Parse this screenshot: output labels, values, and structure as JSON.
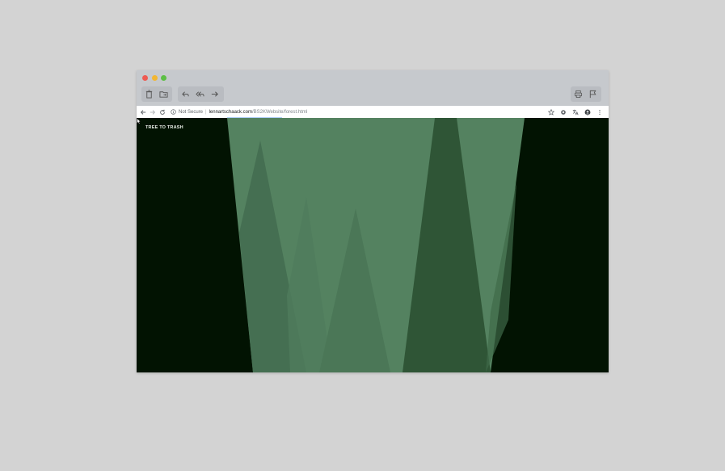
{
  "browser": {
    "traffic_lights": [
      "close",
      "minimize",
      "zoom"
    ],
    "toolbar_left": [
      "trash-icon",
      "folder-icon"
    ],
    "toolbar_mid": [
      "reply-icon",
      "reply-all-icon",
      "forward-icon"
    ],
    "toolbar_right": [
      "print-icon",
      "flag-icon"
    ]
  },
  "navbar": {
    "security_label": "Not Secure",
    "separator": "|",
    "url_host": "lennartschaack.com",
    "url_path": "/BS2KWebsite/forest.html"
  },
  "page": {
    "title": "TREE TO TRASH",
    "colors": {
      "background": "#021302",
      "light_green": "#548260",
      "mid_green": "#456d51",
      "dark_green": "#2e5234"
    }
  }
}
